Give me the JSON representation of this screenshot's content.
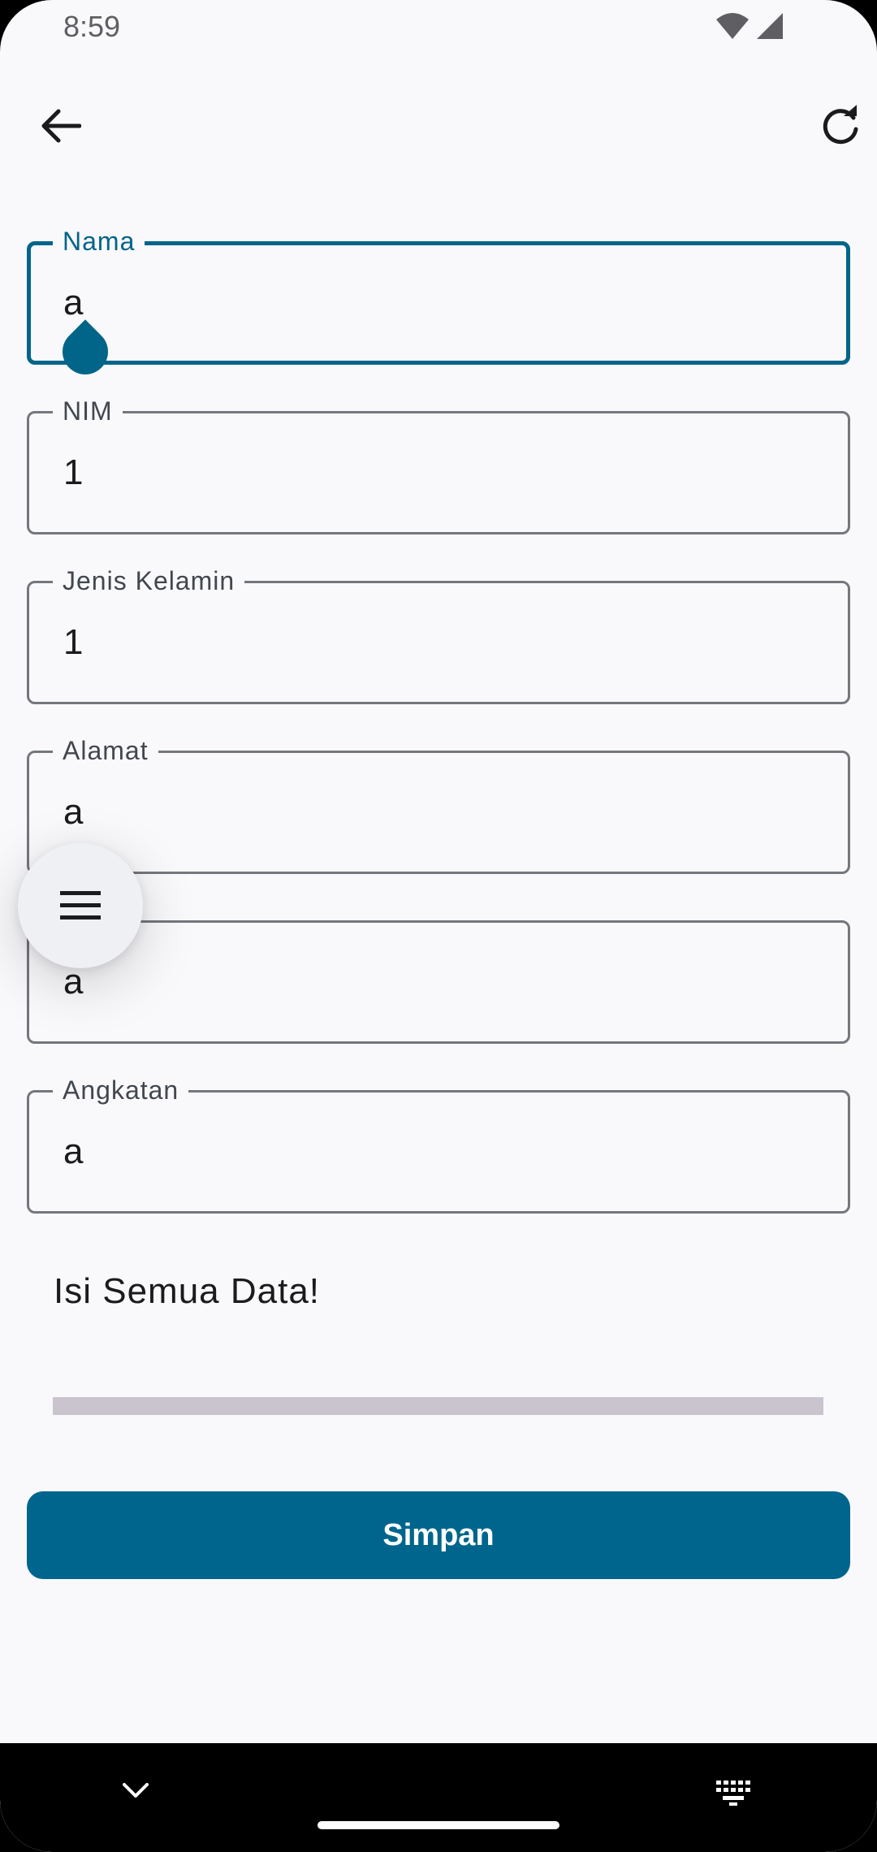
{
  "status_bar": {
    "time": "8:59"
  },
  "toolbar": {
    "back_icon": "arrow-back-icon",
    "refresh_icon": "refresh-icon"
  },
  "form": {
    "fields": [
      {
        "label": "Nama",
        "value": "a",
        "focused": true
      },
      {
        "label": "NIM",
        "value": "1"
      },
      {
        "label": "Jenis Kelamin",
        "value": "1"
      },
      {
        "label": "Alamat",
        "value": "a"
      },
      {
        "label": "",
        "value": "a"
      },
      {
        "label": "Angkatan",
        "value": "a"
      }
    ]
  },
  "message": "Isi Semua Data!",
  "progress": {
    "value": 0
  },
  "save_button": {
    "label": "Simpan"
  },
  "fab": {
    "icon": "menu-icon"
  },
  "colors": {
    "primary": "#006588",
    "background": "#f9f9fc",
    "track": "#cac4cf",
    "outline": "#74777c"
  },
  "nav_bar": {
    "down_icon": "chevron-down-icon",
    "keyboard_icon": "keyboard-icon"
  }
}
